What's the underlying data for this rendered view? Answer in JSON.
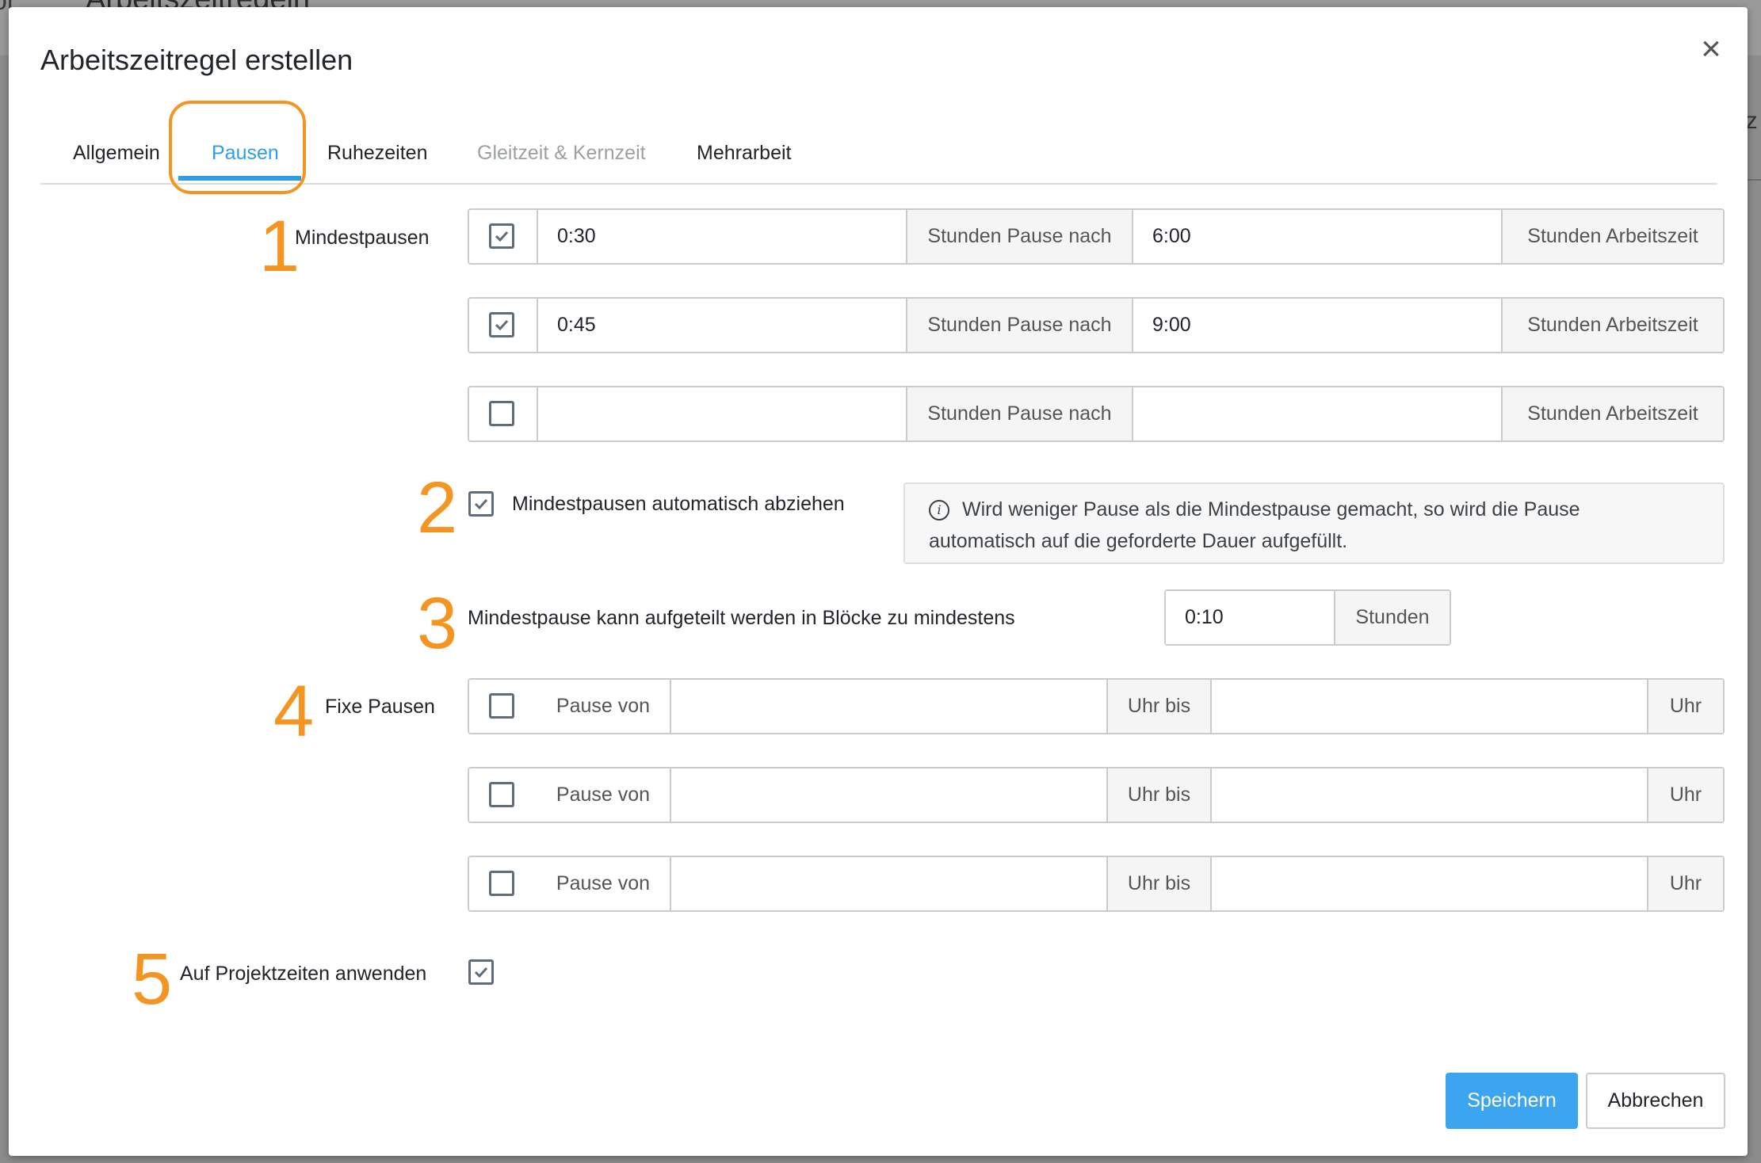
{
  "background": {
    "left_text": "or",
    "title": "Arbeitszeitregeln",
    "right_text": "iz"
  },
  "modal": {
    "title": "Arbeitszeitregel erstellen",
    "close_icon": "close-icon"
  },
  "tabs": [
    {
      "label": "Allgemein",
      "state": "normal"
    },
    {
      "label": "Pausen",
      "state": "active"
    },
    {
      "label": "Ruhezeiten",
      "state": "normal"
    },
    {
      "label": "Gleitzeit & Kernzeit",
      "state": "disabled"
    },
    {
      "label": "Mehrarbeit",
      "state": "normal"
    }
  ],
  "annotations": [
    "1",
    "2",
    "3",
    "4",
    "5"
  ],
  "colors": {
    "accent": "#2f9ee7",
    "highlight": "#f49421",
    "primary_button": "#3ba5ef"
  },
  "mindestpausen": {
    "label": "Mindestpausen",
    "rows": [
      {
        "checked": true,
        "pause": "0:30",
        "addon1": "Stunden Pause nach",
        "arbeitszeit": "6:00",
        "addon2": "Stunden Arbeitszeit"
      },
      {
        "checked": true,
        "pause": "0:45",
        "addon1": "Stunden Pause nach",
        "arbeitszeit": "9:00",
        "addon2": "Stunden Arbeitszeit"
      },
      {
        "checked": false,
        "pause": "",
        "addon1": "Stunden Pause nach",
        "arbeitszeit": "",
        "addon2": "Stunden Arbeitszeit"
      }
    ]
  },
  "auto_deduct": {
    "checked": true,
    "label": "Mindestpausen automatisch abziehen",
    "info_line1": "Wird weniger Pause als die Mindestpause gemacht, so wird die Pause",
    "info_line2": "automatisch auf die geforderte Dauer aufgefüllt.",
    "info_icon": "info-icon"
  },
  "blocks": {
    "label": "Mindestpause kann aufgeteilt werden in Blöcke zu mindestens",
    "value": "0:10",
    "unit": "Stunden"
  },
  "fixe_pausen": {
    "label": "Fixe Pausen",
    "rows": [
      {
        "checked": false,
        "addon1": "Pause von",
        "von": "",
        "addon2": "Uhr bis",
        "bis": "",
        "addon3": "Uhr"
      },
      {
        "checked": false,
        "addon1": "Pause von",
        "von": "",
        "addon2": "Uhr bis",
        "bis": "",
        "addon3": "Uhr"
      },
      {
        "checked": false,
        "addon1": "Pause von",
        "von": "",
        "addon2": "Uhr bis",
        "bis": "",
        "addon3": "Uhr"
      }
    ]
  },
  "projektzeiten": {
    "label": "Auf Projektzeiten anwenden",
    "checked": true
  },
  "buttons": {
    "save": "Speichern",
    "cancel": "Abbrechen"
  }
}
